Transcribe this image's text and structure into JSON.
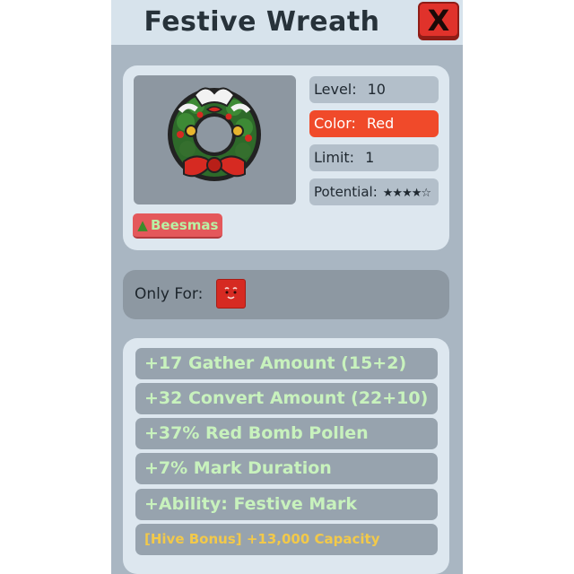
{
  "window": {
    "title": "Festive Wreath",
    "close_label": "X"
  },
  "item": {
    "image_icon": "festive-wreath-icon",
    "stats": {
      "level": {
        "label": "Level:",
        "value": "10"
      },
      "color": {
        "label": "Color:",
        "value": "Red"
      },
      "limit": {
        "label": "Limit:",
        "value": "1"
      },
      "potential": {
        "label": "Potential:",
        "value": "★★★★☆"
      }
    },
    "tag": {
      "icon": "christmas-tree-icon",
      "label": "Beesmas"
    }
  },
  "only_for": {
    "label": "Only For:",
    "icon": "red-bee-icon"
  },
  "abilities": [
    "+17 Gather Amount (15+2)",
    "+32 Convert Amount (22+10)",
    "+37% Red Bomb Pollen",
    "+7% Mark Duration",
    "+Ability: Festive Mark"
  ],
  "hive_bonus": "[Hive Bonus] +13,000 Capacity",
  "colors": {
    "accent_red": "#f04a2a",
    "close_red": "#e0322b",
    "ability_text": "#c8f2bd",
    "bonus_text": "#f2c94a"
  }
}
